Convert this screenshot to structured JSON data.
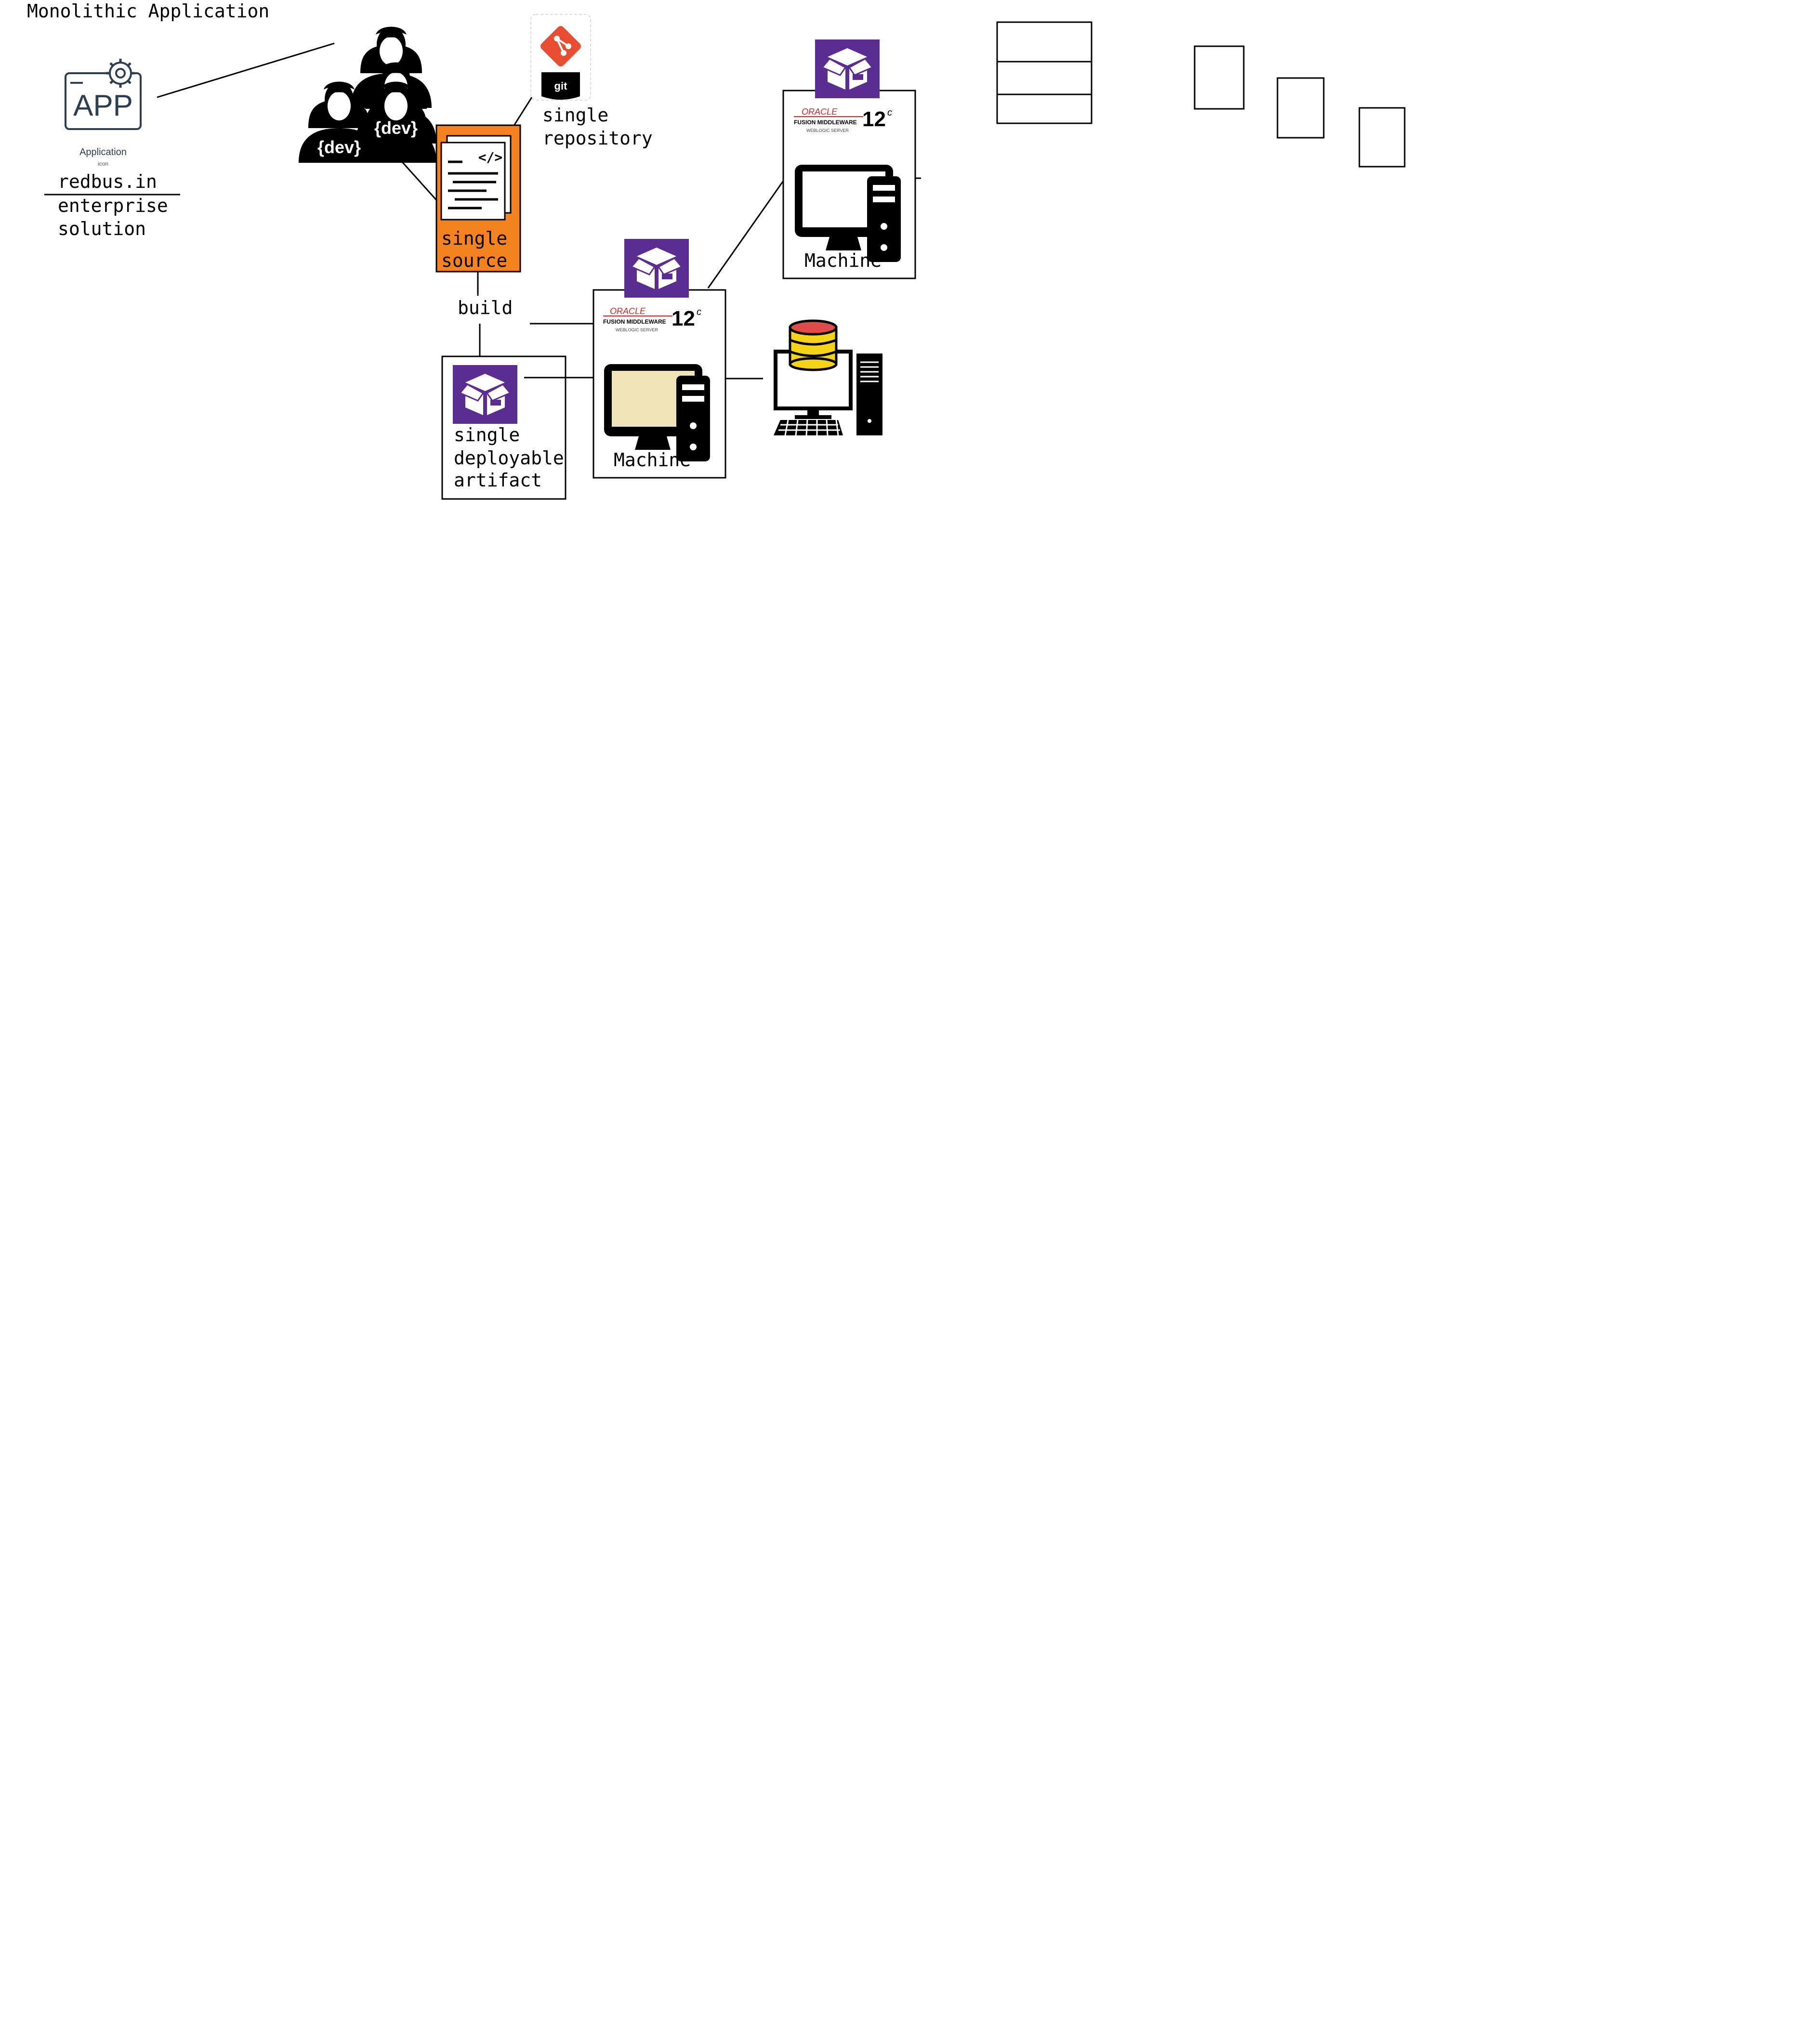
{
  "diagram": {
    "title": "Monolithic Application",
    "app": {
      "icon_text": "APP",
      "icon_caption": "Application",
      "icon_subcaption": "icon",
      "name": "redbus.in",
      "description_line1": "enterprise",
      "description_line2": "solution"
    },
    "developers": {
      "badge": "{dev}",
      "count": 4
    },
    "repository": {
      "icon_text": "git",
      "label_line1": "single",
      "label_line2": "repository"
    },
    "source": {
      "label_line1": "single",
      "label_line2": "source",
      "code_glyph": "</>"
    },
    "build": {
      "label": "build"
    },
    "artifact": {
      "label_line1": "single",
      "label_line2": "deployable",
      "label_line3": "artifact"
    },
    "servers": [
      {
        "vendor": "ORACLE",
        "product": "FUSION MIDDLEWARE",
        "edition": "WEBLOGIC SERVER",
        "version": "12",
        "version_suffix": "c",
        "machine_label": "Machine"
      },
      {
        "vendor": "ORACLE",
        "product": "FUSION MIDDLEWARE",
        "edition": "WEBLOGIC SERVER",
        "version": "12",
        "version_suffix": "c",
        "machine_label": "Machine"
      }
    ],
    "colors": {
      "source_orange": "#f58220",
      "package_purple": "#5c2d91",
      "git_red": "#e84e31",
      "oracle_red": "#e3262a",
      "monitor_screen": "#efe4b7",
      "db_yellow": "#f5d316",
      "db_top_red": "#e24b4b",
      "ink": "#000000"
    }
  }
}
